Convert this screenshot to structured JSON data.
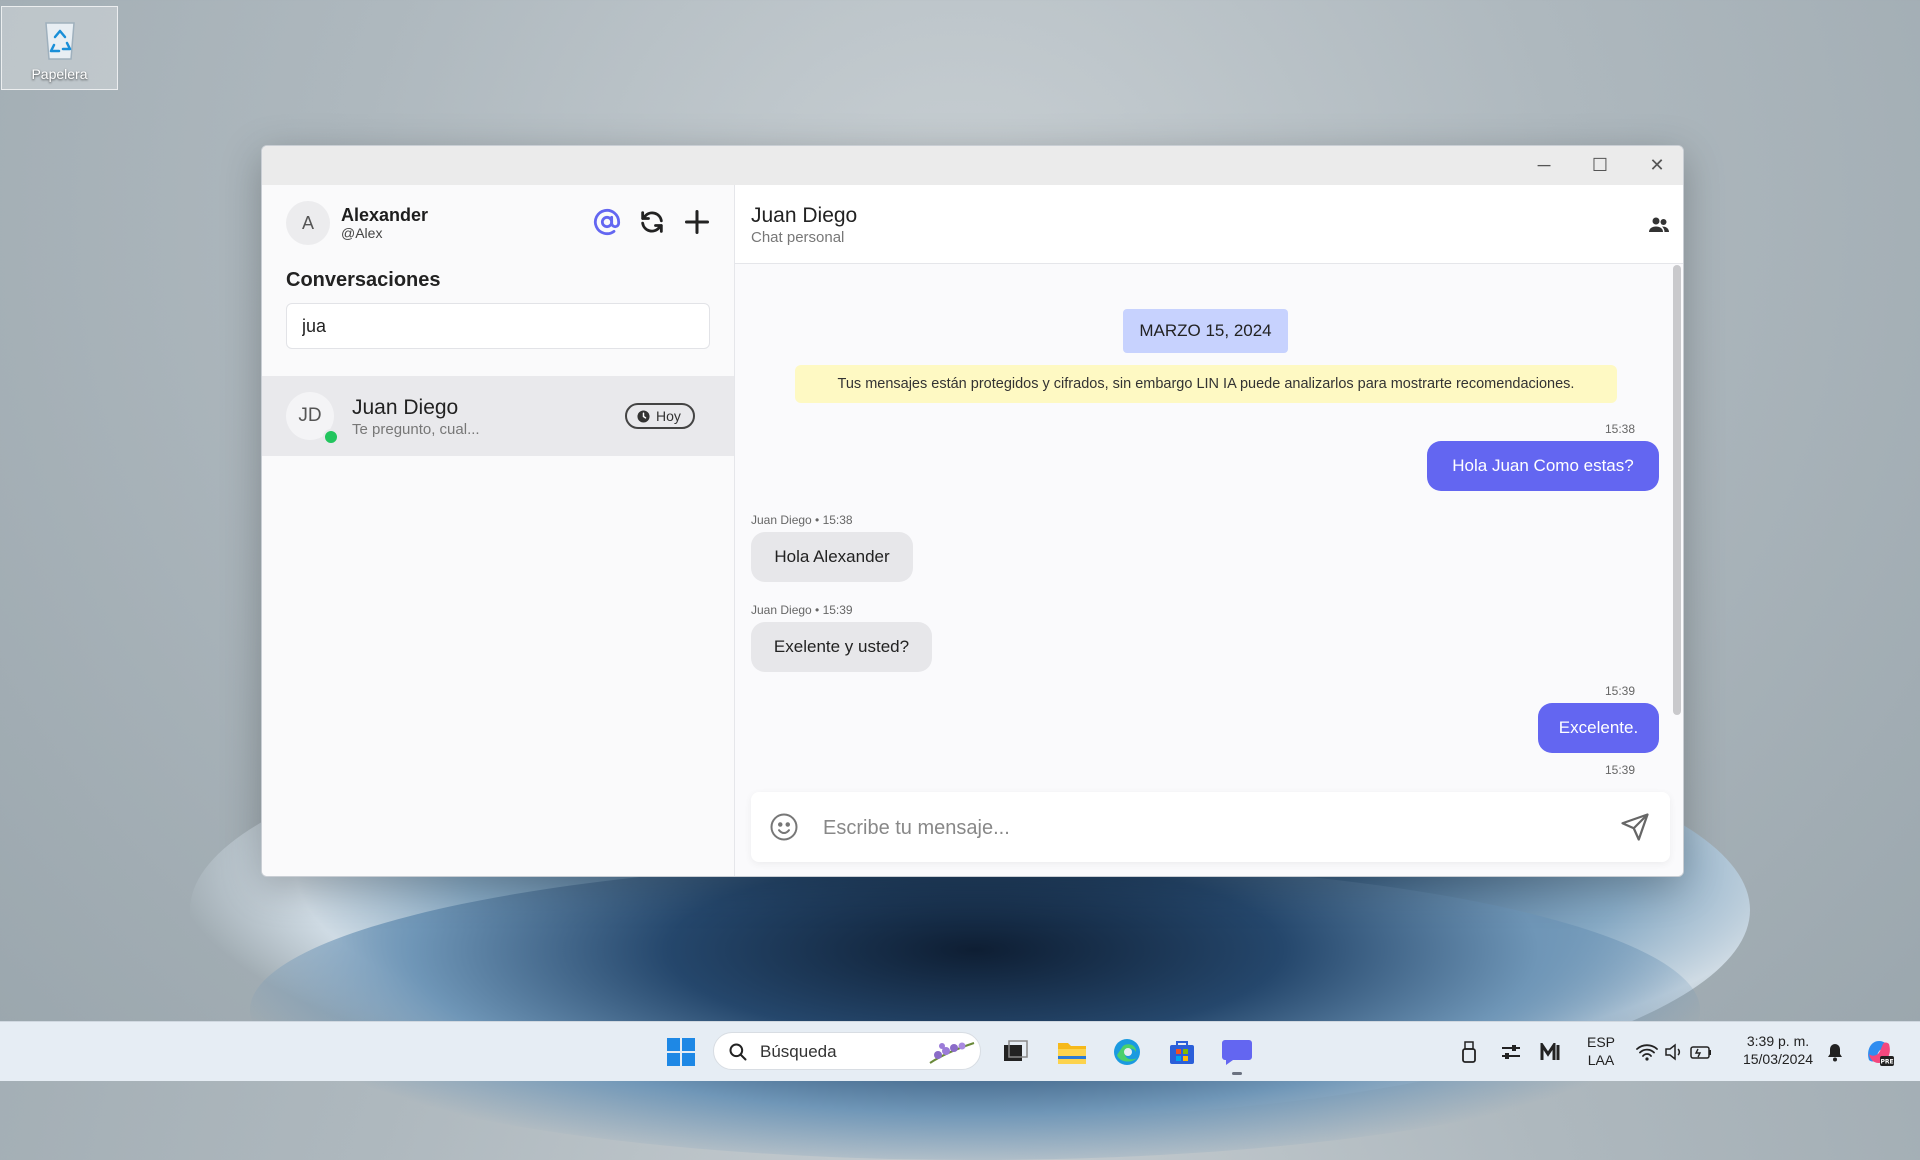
{
  "desktop": {
    "icon_label": "Papelera"
  },
  "window": {
    "minimize": "─",
    "maximize": "☐",
    "close": "✕"
  },
  "sidebar": {
    "user": {
      "initial": "A",
      "name": "Alexander",
      "handle": "@Alex"
    },
    "section_title": "Conversaciones",
    "search_value": "jua",
    "conversations": [
      {
        "initials": "JD",
        "name": "Juan Diego",
        "preview": "Te pregunto, cual...",
        "badge": "Hoy",
        "online": true
      }
    ]
  },
  "chat": {
    "header": {
      "name": "Juan Diego",
      "subtitle": "Chat personal"
    },
    "date_separator": "MARZO 15, 2024",
    "notice": "Tus mensajes están protegidos y cifrados, sin embargo LIN IA puede analizarlos para mostrarte recomendaciones.",
    "messages": [
      {
        "direction": "out",
        "meta": "15:38",
        "text": "Hola Juan Como estas?"
      },
      {
        "direction": "in",
        "meta": "Juan Diego • 15:38",
        "text": "Hola Alexander"
      },
      {
        "direction": "in",
        "meta": "Juan Diego • 15:39",
        "text": "Exelente y usted?"
      },
      {
        "direction": "out",
        "meta": "15:39",
        "text": "Excelente."
      },
      {
        "direction": "out",
        "meta": "15:39",
        "text": ""
      }
    ],
    "composer": {
      "placeholder": "Escribe tu mensaje..."
    }
  },
  "taskbar": {
    "search_placeholder": "Búsqueda",
    "language": "ESP",
    "layout": "LAA",
    "time": "3:39 p. m.",
    "date": "15/03/2024"
  },
  "colors": {
    "accent": "#6366f1",
    "date_pill": "#c7d2fe",
    "notice": "#fef9c3",
    "online": "#22c55e"
  }
}
